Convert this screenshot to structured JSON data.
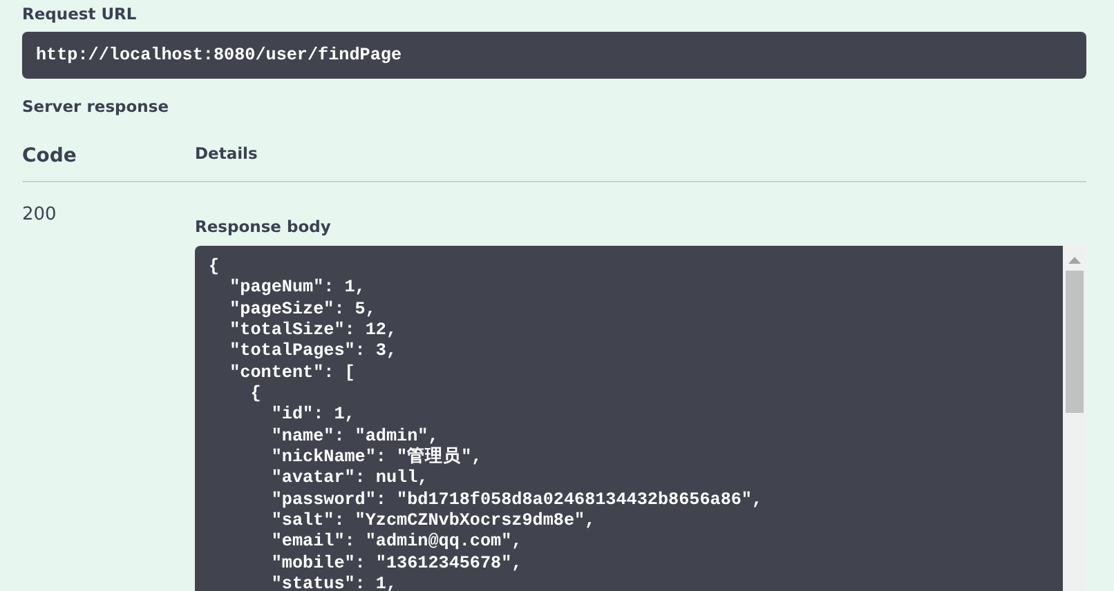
{
  "request_url": {
    "label": "Request URL",
    "value": "http://localhost:8080/user/findPage"
  },
  "server_response": {
    "label": "Server response",
    "columns": [
      "Code",
      "Details"
    ],
    "rows": [
      {
        "code": "200",
        "details_label": "Response body",
        "body_lines": [
          "{",
          "  \"pageNum\": 1,",
          "  \"pageSize\": 5,",
          "  \"totalSize\": 12,",
          "  \"totalPages\": 3,",
          "  \"content\": [",
          "    {",
          "      \"id\": 1,",
          "      \"name\": \"admin\",",
          "      \"nickName\": \"管理员\",",
          "      \"avatar\": null,",
          "      \"password\": \"bd1718f058d8a02468134432b8656a86\",",
          "      \"salt\": \"YzcmCZNvbXocrsz9dm8e\",",
          "      \"email\": \"admin@qq.com\",",
          "      \"mobile\": \"13612345678\",",
          "      \"status\": 1,"
        ]
      }
    ]
  }
}
